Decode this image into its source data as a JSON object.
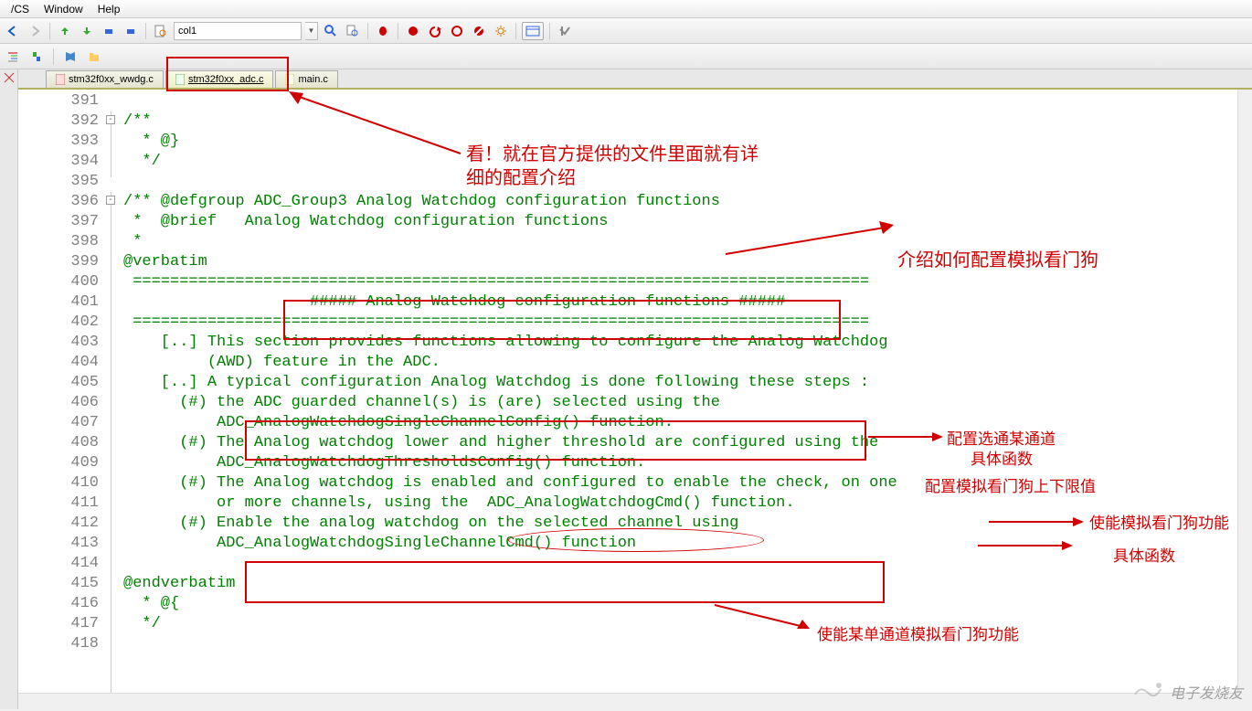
{
  "menubar": {
    "items": [
      "/CS",
      "Window",
      "Help"
    ]
  },
  "toolbar": {
    "search_value": "col1"
  },
  "tabs": [
    {
      "name": "stm32f0xx_wwdg.c",
      "active": false
    },
    {
      "name": "stm32f0xx_adc.c",
      "active": true,
      "hred": true
    },
    {
      "name": "main.c",
      "active": false
    }
  ],
  "lines": {
    "start": 391,
    "end": 418,
    "code": [
      "",
      "/**",
      "  * @}",
      "  */",
      "",
      "/** @defgroup ADC_Group3 Analog Watchdog configuration functions",
      " *  @brief   Analog Watchdog configuration functions",
      " *",
      "@verbatim",
      " ===============================================================================",
      "                    ##### Analog Watchdog configuration functions #####",
      " ===============================================================================",
      "    [..] This section provides functions allowing to configure the Analog Watchdog",
      "         (AWD) feature in the ADC.",
      "    [..] A typical configuration Analog Watchdog is done following these steps :",
      "      (#) the ADC guarded channel(s) is (are) selected using the",
      "          ADC_AnalogWatchdogSingleChannelConfig() function.",
      "      (#) The Analog watchdog lower and higher threshold are configured using the",
      "          ADC_AnalogWatchdogThresholdsConfig() function.",
      "      (#) The Analog watchdog is enabled and configured to enable the check, on one",
      "          or more channels, using the  ADC_AnalogWatchdogCmd() function.",
      "      (#) Enable the analog watchdog on the selected channel using",
      "          ADC_AnalogWatchdogSingleChannelCmd() function",
      "",
      "@endverbatim",
      "  * @{",
      "  */",
      ""
    ]
  },
  "annotations": {
    "a1_l1": "看！就在官方提供的文件里面就有详",
    "a1_l2": "细的配置介绍",
    "a2": "介绍如何配置模拟看门狗",
    "a3_l1": "配置选通某通道",
    "a3_l2": "具体函数",
    "a4": "配置模拟看门狗上下限值",
    "a5": "使能模拟看门狗功能",
    "a6": "具体函数",
    "a7": "使能某单通道模拟看门狗功能"
  },
  "watermark": {
    "text": "电子发烧友",
    "url": "http://bbs.elecfans.com"
  }
}
